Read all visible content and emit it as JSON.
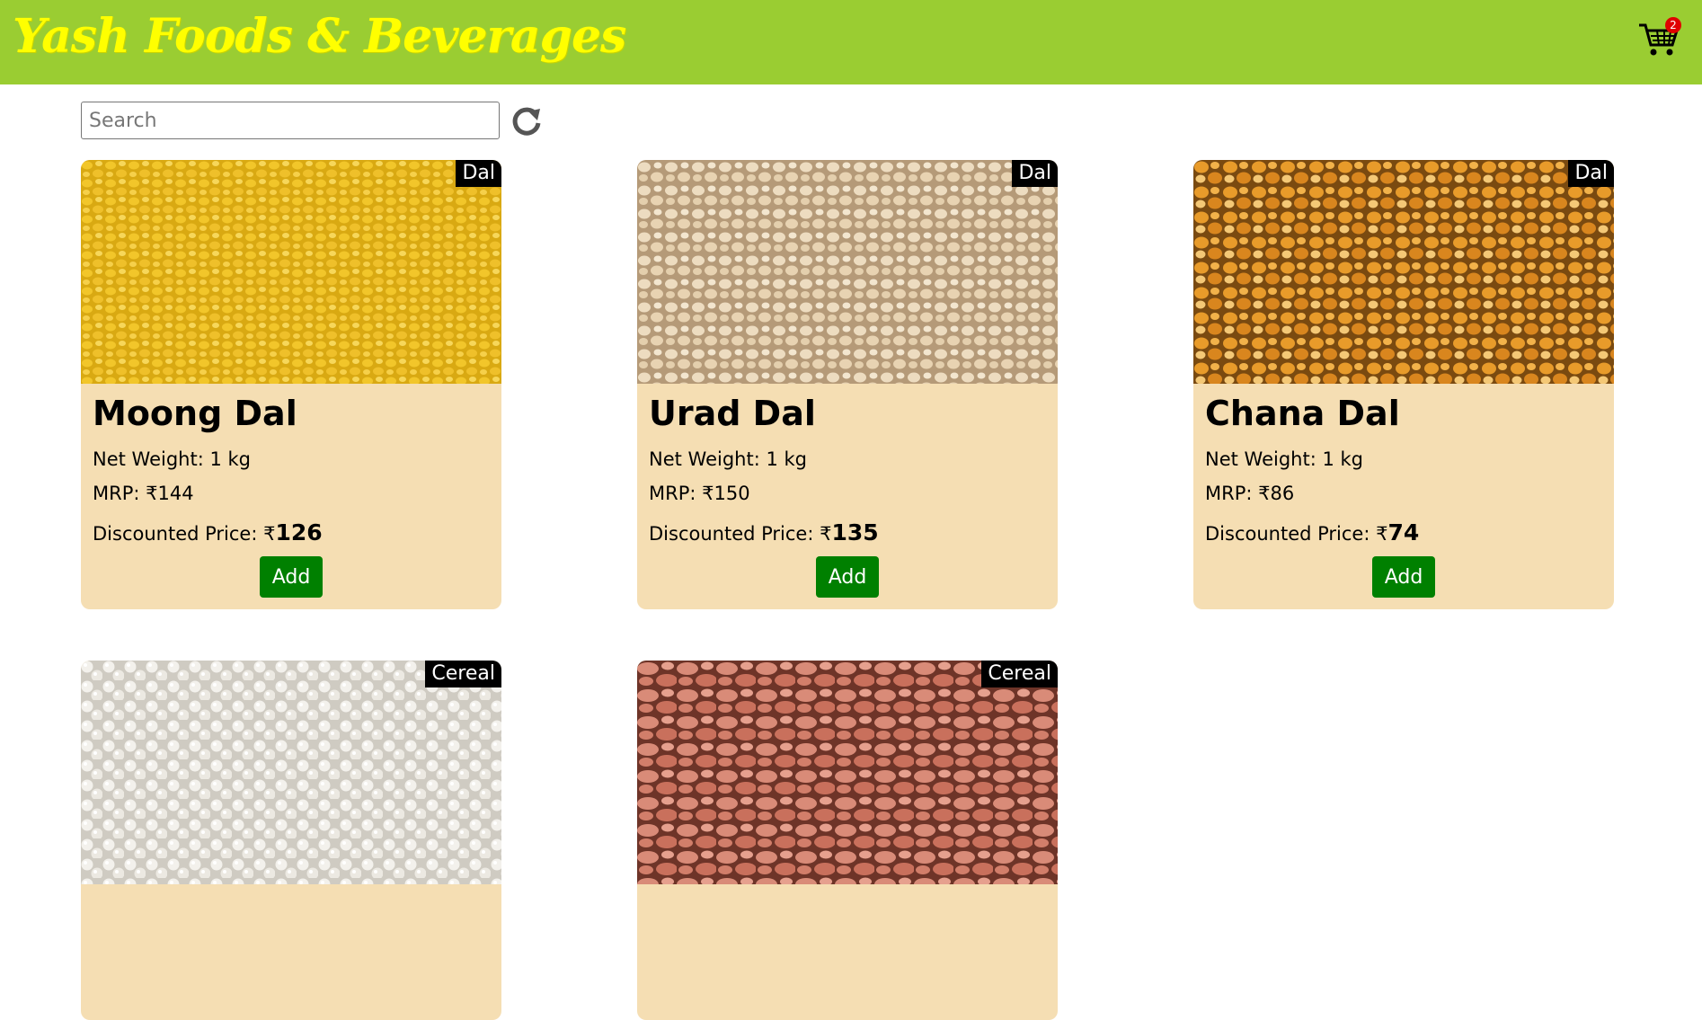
{
  "header": {
    "brand": "Yash Foods & Beverages",
    "cart_count": "2",
    "cart_icon": "shopping-cart-icon",
    "background": "#9ACD32",
    "brand_color": "#FFFF00"
  },
  "search": {
    "placeholder": "Search",
    "value": "",
    "refresh_icon": "refresh-icon"
  },
  "products": [
    {
      "category": "Dal",
      "name": "Moong Dal",
      "weight": "Net Weight: 1 kg",
      "mrp": "MRP: ₹144",
      "discount_label": "Discounted Price: ₹",
      "discount_value": "126",
      "button": "Add"
    },
    {
      "category": "Dal",
      "name": "Urad Dal",
      "weight": "Net Weight: 1 kg",
      "mrp": "MRP: ₹150",
      "discount_label": "Discounted Price: ₹",
      "discount_value": "135",
      "button": "Add"
    },
    {
      "category": "Dal",
      "name": "Chana Dal",
      "weight": "Net Weight: 1 kg",
      "mrp": "MRP: ₹86",
      "discount_label": "Discounted Price: ₹",
      "discount_value": "74",
      "button": "Add"
    },
    {
      "category": "Cereal"
    },
    {
      "category": "Cereal"
    }
  ],
  "colors": {
    "card_bg": "#F5DEB3",
    "add_button": "#008000",
    "tag_bg": "#000000"
  }
}
